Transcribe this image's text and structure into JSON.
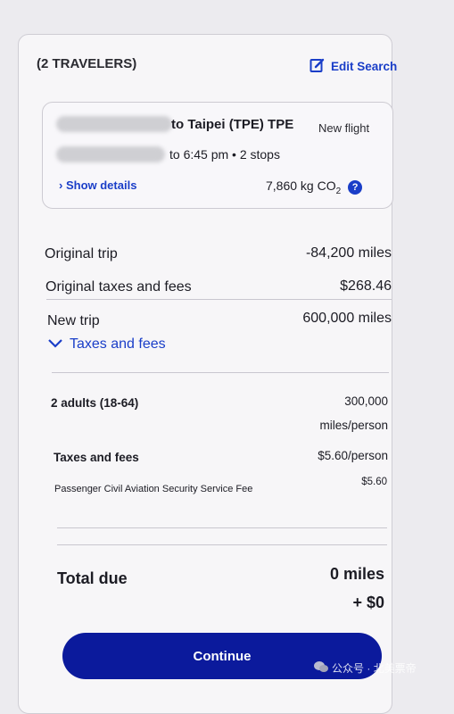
{
  "header": {
    "travelers": "(2 TRAVELERS)",
    "edit_search": "Edit Search"
  },
  "flight": {
    "route": "to Taipei (TPE) TPE",
    "badge": "New flight",
    "times": "to 6:45 pm • 2 stops",
    "show_details": "Show details",
    "co2_value": "7,860 kg CO",
    "co2_sub": "2"
  },
  "summary": {
    "original_trip_label": "Original trip",
    "original_trip_value": "-84,200 miles",
    "original_taxes_label": "Original taxes and fees",
    "original_taxes_value": "$268.46",
    "new_trip_label": "New trip",
    "new_trip_value": "600,000 miles",
    "taxes_toggle": "Taxes and fees"
  },
  "breakdown": {
    "adults_label": "2 adults (18-64)",
    "adults_value_line1": "300,000",
    "adults_value_line2": "miles/person",
    "taxes_label": "Taxes and fees",
    "taxes_value": "$5.60/person",
    "fee_label": "Passenger Civil Aviation Security Service Fee",
    "fee_value": "$5.60"
  },
  "total": {
    "label": "Total due",
    "miles": "0 miles",
    "cash": "+ $0"
  },
  "actions": {
    "continue": "Continue"
  },
  "watermark": {
    "text": "公众号 · 北美票帝"
  },
  "colors": {
    "accent": "#1a3ec8",
    "button": "#0b1a9c"
  }
}
